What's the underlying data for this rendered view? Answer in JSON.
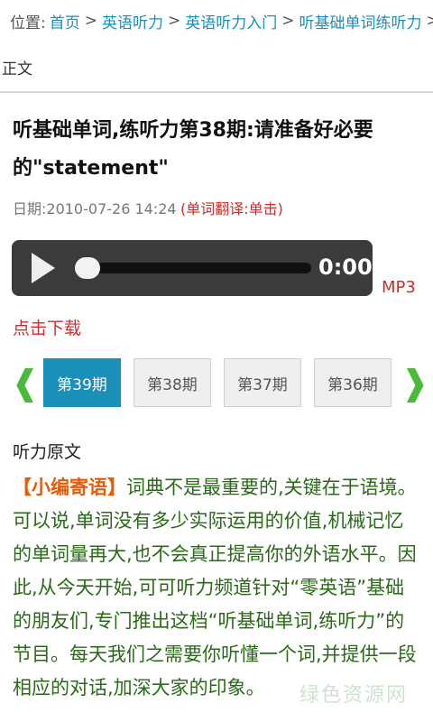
{
  "breadcrumb": {
    "prefix": "位置:",
    "items": [
      "首页",
      "英语听力",
      "英语听力入门",
      "听基础单词练听力"
    ],
    "separator": ">",
    "tail": "正文"
  },
  "article": {
    "title": "听基础单词,练听力第38期:请准备好必要的\"statement\"",
    "date": "日期:2010-07-26 14:24",
    "translate_hint": "(单词翻译:单击)"
  },
  "player": {
    "time": "0:00",
    "format": "MP3"
  },
  "download_label": "点击下载",
  "episode_tabs": {
    "prev": "❰",
    "next": "❱",
    "items": [
      "第39期",
      "第38期",
      "第37期",
      "第36期"
    ],
    "active_index": 0
  },
  "content": {
    "heading": "听力原文",
    "lead": "【小编寄语】",
    "text": "词典不是最重要的,关键在于语境。可以说,单词没有多少实际运用的价值,机械记忆的单词量再大,也不会真正提高你的外语水平。因此,从今天开始,可可听力频道针对“零英语”基础的朋友们,专门推出这档“听基础单词,练听力”的节目。每天我们之需要你听懂一个词,并提供一段相应的对话,加深大家的印象。"
  },
  "watermark": "绿色资源网",
  "colors": {
    "link": "#1a8fb8",
    "accent_red": "#d62a2a",
    "text_green": "#2a6a18",
    "lead_orange": "#e65c0a",
    "arrow_green": "#4aba3a",
    "player_bg": "#3b3b3b"
  }
}
